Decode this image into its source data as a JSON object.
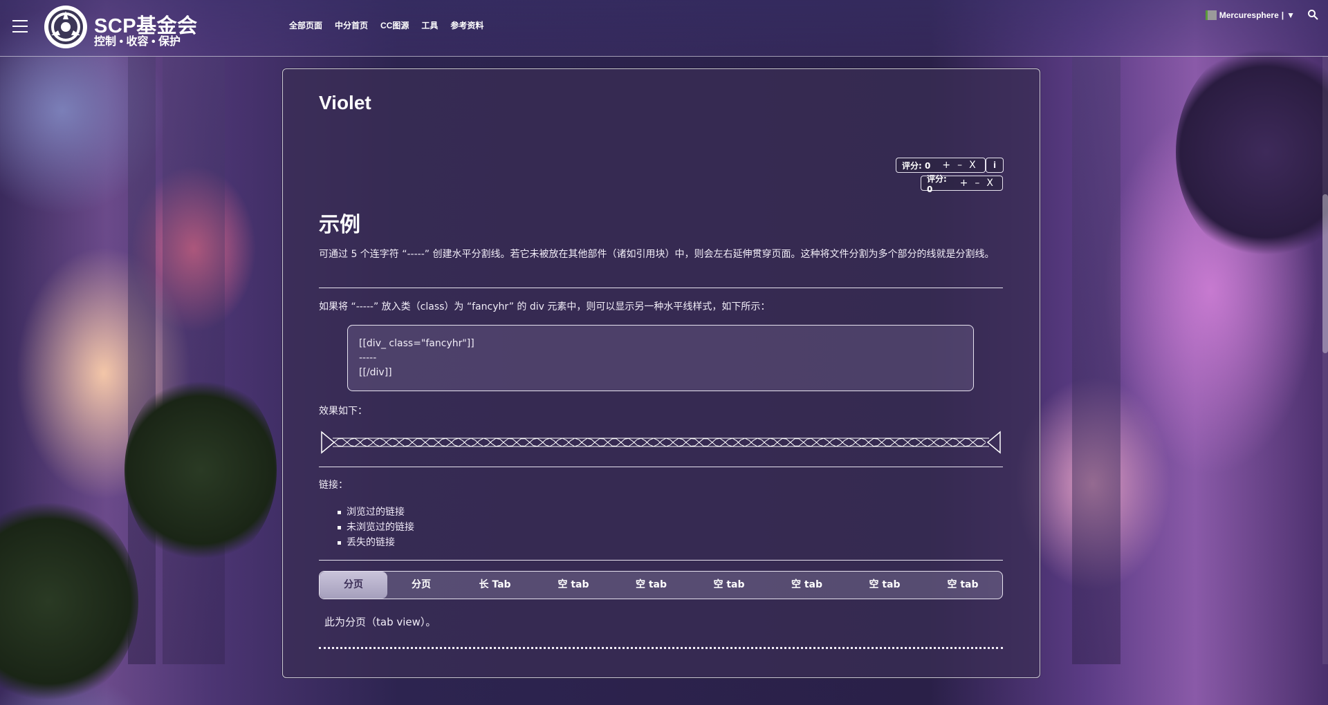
{
  "header": {
    "site_name": "SCP基金会",
    "site_tagline": "控制 • 收容 • 保护",
    "nav": [
      "全部页面",
      "中分首页",
      "CC图源",
      "工具",
      "参考资料"
    ],
    "user": "Mercuresphere",
    "user_sep": "|",
    "user_menu": "▼"
  },
  "page": {
    "title": "Violet",
    "rating1": {
      "label": "评分: 0",
      "plus": "+",
      "minus": "–",
      "close": "X"
    },
    "info": "i",
    "rating2": {
      "label": "评分: 0",
      "plus": "+",
      "minus": "–",
      "close": "X"
    },
    "section_title": "示例",
    "para1": "可通过 5 个连字符 “-----” 创建水平分割线。若它未被放在其他部件（诸如引用块）中，则会左右延伸贯穿页面。这种将文件分割为多个部分的线就是分割线。",
    "para2": "如果将 “-----” 放入类（class）为 “fancyhr” 的 div 元素中，则可以显示另一种水平线样式，如下所示：",
    "code": [
      "[[div_ class=\"fancyhr\"]]",
      "-----",
      "[[/div]]"
    ],
    "effect_label": "效果如下：",
    "links_label": "链接：",
    "links": [
      "浏览过的链接",
      "未浏览过的链接",
      "丢失的链接"
    ],
    "tabs": [
      "分页",
      "分页",
      "长 Tab",
      "空 tab",
      "空 tab",
      "空 tab",
      "空 tab",
      "空 tab",
      "空 tab"
    ],
    "active_tab": 0,
    "tab_content": "此为分页（tab view）。"
  },
  "colors": {
    "panel": "#3a2e54",
    "accent": "#c9c3da",
    "text": "#f2eef8"
  }
}
